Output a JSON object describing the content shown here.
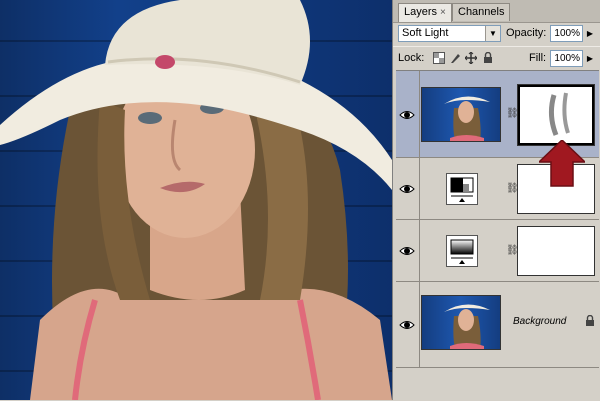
{
  "panel": {
    "tabs": [
      {
        "label": "Layers",
        "close": "×",
        "active": true
      },
      {
        "label": "Channels",
        "active": false
      }
    ],
    "blend_mode": "Soft Light",
    "opacity_label": "Opacity:",
    "opacity_value": "100%",
    "lock_label": "Lock:",
    "fill_label": "Fill:",
    "fill_value": "100%",
    "layers": [
      {
        "type": "image-with-mask",
        "selected": true,
        "visible": true
      },
      {
        "type": "levels-adjustment",
        "selected": false,
        "visible": true
      },
      {
        "type": "gradient-map-adjustment",
        "selected": false,
        "visible": true
      },
      {
        "type": "background",
        "name": "Background",
        "visible": true,
        "locked": true
      }
    ]
  },
  "icons": {
    "eye": "eye-icon",
    "chain": "chain-link-icon",
    "lock": "lock-icon",
    "pointer": "red-arrow-icon"
  },
  "colors": {
    "selected_layer": "#a9b2c9",
    "pointer_arrow": "#a01820"
  }
}
